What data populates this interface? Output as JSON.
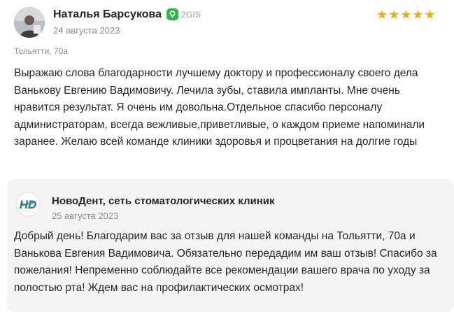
{
  "review": {
    "author_name": "Наталья Барсукова",
    "source_label": "2GIS",
    "date": "24 августа 2023",
    "rating": 5,
    "stars": [
      "★",
      "★",
      "★",
      "★",
      "★"
    ],
    "location": "Тольятти, 70а",
    "text": "Выражаю слова благодарности лучшему доктору и профессионалу своего дела Ванькову Евгению Вадимовичу. Лечила зубы, ставила импланты. Мне очень нравится результат. Я очень им довольна.Отдельное спасибо персоналу администраторам, всегда вежливые,приветливые, о каждом приеме напоминали заранее. Желаю всей команде клиники здоровья и процветания на долгие годы"
  },
  "reply": {
    "author_name": "НовоДент, сеть стоматологических клиник",
    "logo_text": "HD",
    "date": "25 августа 2023",
    "text": "Добрый день! Благодарим вас за отзыв для нашей команды на Тольятти, 70а и Ванькова Евгения Вадимовича. Обязательно передадим им ваш отзыв! Спасибо за пожелания! Непременно соблюдайте все рекомендации вашего врача по уходу за полостью рта! Ждем вас на профилактических осмотрах!"
  },
  "colors": {
    "star": "#f2b003",
    "source_icon": "#2fb44a",
    "reply_bg": "#f4f4f4",
    "logo_blue": "#1565c0",
    "logo_green": "#43a047"
  }
}
